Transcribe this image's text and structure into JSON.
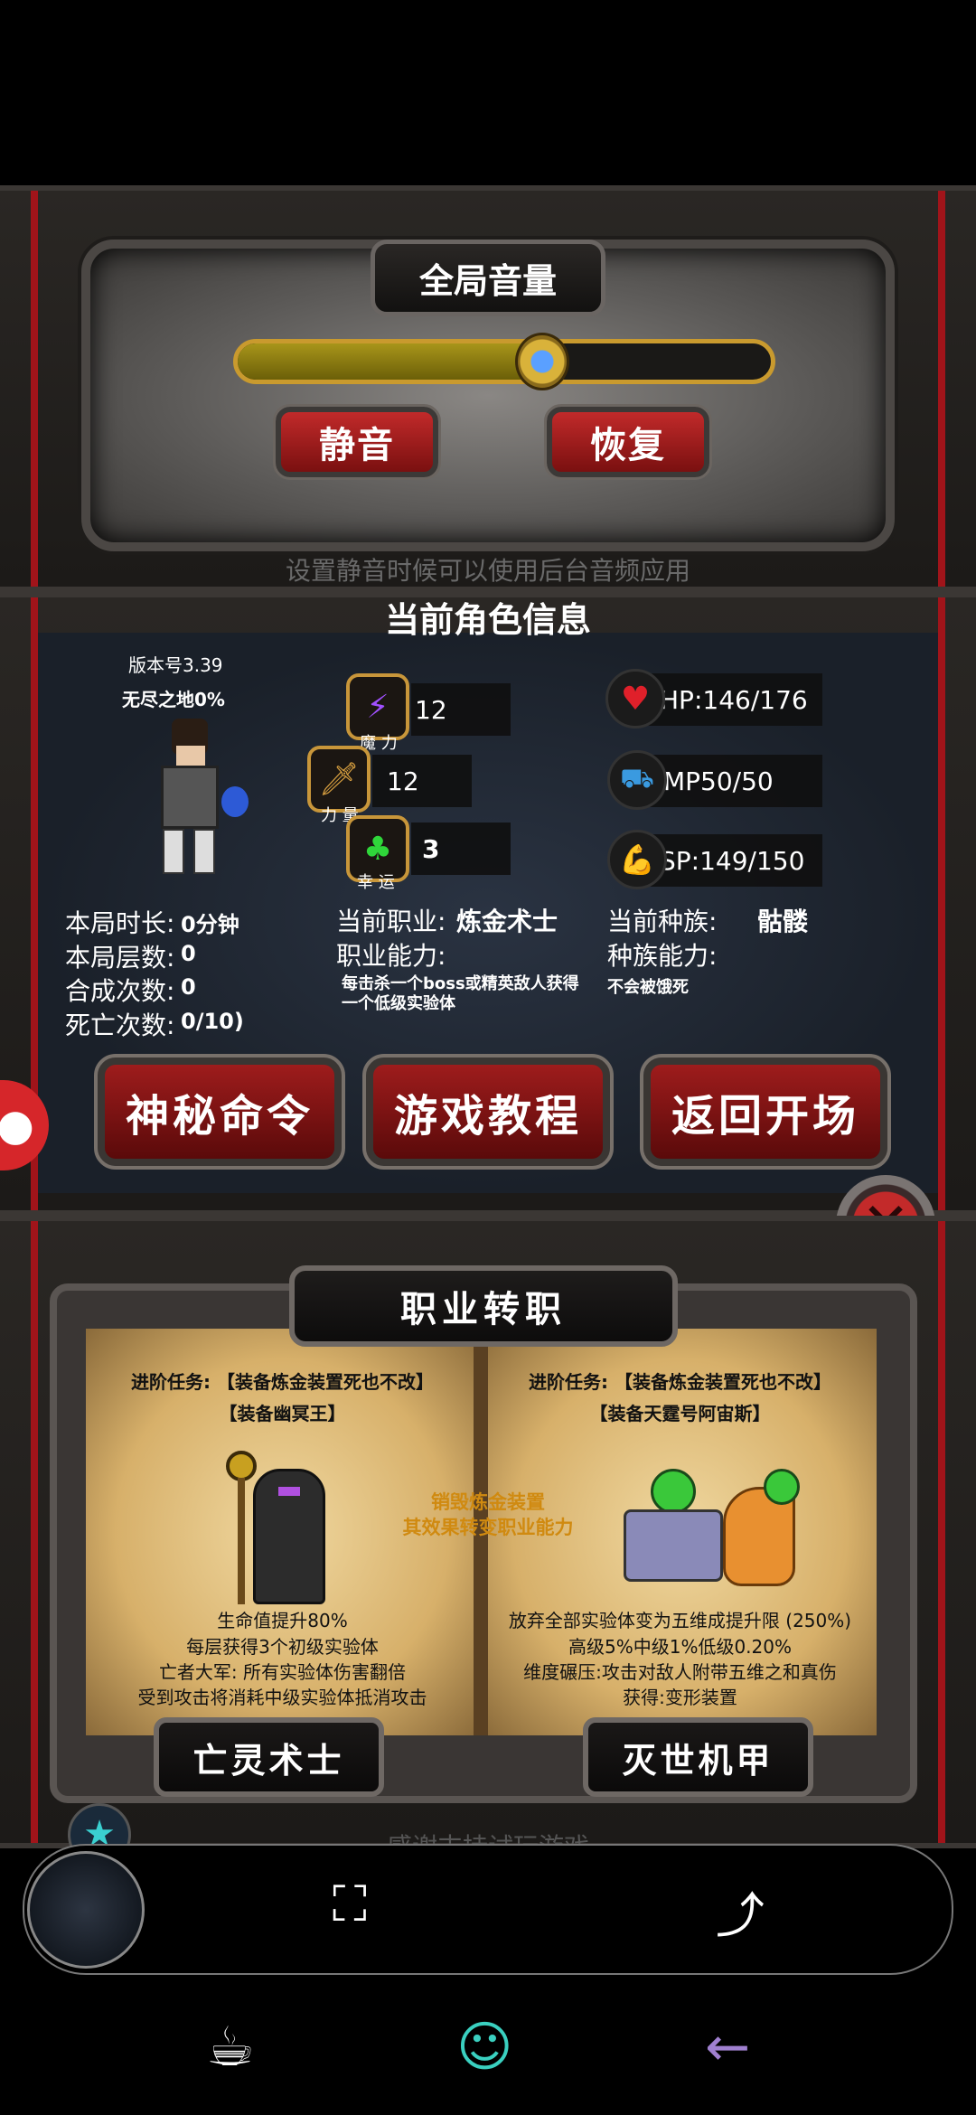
{
  "volume": {
    "title": "全局音量",
    "level": 0.57,
    "mute_label": "静音",
    "restore_label": "恢复",
    "hint": "设置静音时候可以使用后台音频应用"
  },
  "character": {
    "section_title": "当前角色信息",
    "version": "版本号3.39",
    "mode": "无尽之地0%",
    "magic_value": "12",
    "magic_label": "魔 力",
    "strength_value": "12",
    "strength_label": "力 量",
    "luck_value": "3",
    "luck_label": "幸 运",
    "hp": "HP:146/176",
    "mp": "MP50/50",
    "sp": "SP:149/150",
    "run_time_label": "本局时长:",
    "run_time": "0分钟",
    "floors_label": "本局层数:",
    "floors": "0",
    "synth_label": "合成次数:",
    "synth": "0",
    "deaths_label": "死亡次数:",
    "deaths": "0/10)",
    "job_label": "当前职业:",
    "job": "炼金术士",
    "job_ability_label": "职业能力:",
    "job_ability": "每击杀一个boss或精英敌人获得一个低级实验体",
    "race_label": "当前种族:",
    "race": "骷髅",
    "race_ability_label": "种族能力:",
    "race_ability": "不会被饿死"
  },
  "buttons": {
    "secret": "神秘命令",
    "tutorial": "游戏教程",
    "back": "返回开场"
  },
  "job_change": {
    "title": "职业转职",
    "left": {
      "task_line1": "进阶任务: 【装备炼金装置死也不改】",
      "task_line2": "【装备幽冥王】",
      "effects": [
        "生命值提升80%",
        "每层获得3个初级实验体",
        "亡者大军: 所有实验体伤害翻倍",
        "受到攻击将消耗中级实验体抵消攻击"
      ],
      "name": "亡灵术士"
    },
    "center": [
      "销毁炼金装置",
      "其效果转变职业能力"
    ],
    "right": {
      "task_line1": "进阶任务: 【装备炼金装置死也不改】",
      "task_line2": "【装备天霆号阿宙斯】",
      "effects": [
        "放弃全部实验体变为五维成提升限 (250%)",
        "高级5%中级1%低级0.20%",
        "维度碾压:攻击对敌人附带五维之和真伤",
        "获得:变形装置"
      ],
      "name": "灭世机甲"
    },
    "footer_partial": "感谢支持试玩游戏"
  },
  "icons": {
    "magic": "lightning-icon",
    "strength": "sword-icon",
    "luck": "clover-icon",
    "hp": "heart-icon",
    "mp": "mp-icon",
    "sp": "muscle-icon"
  },
  "colors": {
    "accent_red": "#a0141a",
    "gold": "#c99a2e",
    "parchment": "#e3c483"
  }
}
